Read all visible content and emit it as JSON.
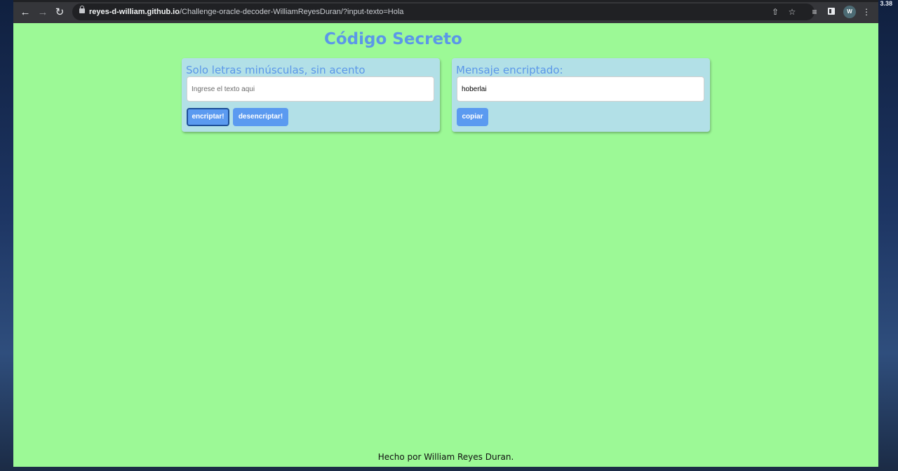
{
  "desktop": {
    "clock_text": "3.38"
  },
  "browser": {
    "url_host": "reyes-d-william.github.io",
    "url_path": "/Challenge-oracle-decoder-WilliamReyesDuran/?input-texto=Hola",
    "profile_initial": "W",
    "icons": {
      "back": "arrow-left",
      "forward": "arrow-right",
      "reload": "reload",
      "lock": "lock",
      "share": "share",
      "bookmark": "star",
      "reading_list": "reading-list",
      "side_panel": "side-panel",
      "menu": "kebab-menu"
    }
  },
  "page": {
    "title": "Código Secreto",
    "left_panel": {
      "heading": "Solo letras minúsculas, sin acento",
      "input_placeholder": "Ingrese el texto aqui",
      "encrypt_label": "encriptar!",
      "decrypt_label": "desencriptar!"
    },
    "right_panel": {
      "heading": "Mensaje encriptado:",
      "output_value": "hoberlai",
      "copy_label": "copiar"
    },
    "footer": "Hecho por William Reyes Duran."
  },
  "colors": {
    "page_background": "#9cf996",
    "card_background": "#b2e0e7",
    "accent_blue": "#5b97e8",
    "button_blue": "#5b9af0"
  }
}
